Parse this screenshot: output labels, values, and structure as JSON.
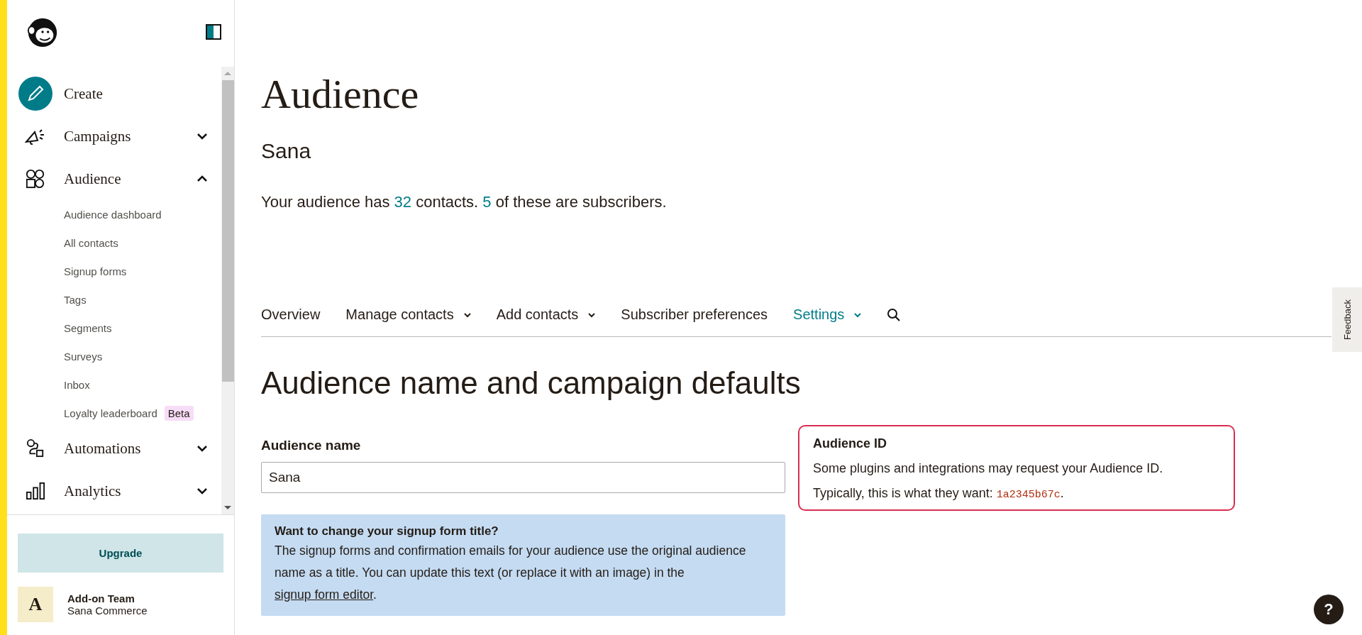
{
  "sidebar": {
    "nav": [
      {
        "label": "Create",
        "kind": "create"
      },
      {
        "label": "Campaigns",
        "kind": "section",
        "expanded": false
      },
      {
        "label": "Audience",
        "kind": "section",
        "expanded": true,
        "children": [
          {
            "label": "Audience dashboard"
          },
          {
            "label": "All contacts"
          },
          {
            "label": "Signup forms"
          },
          {
            "label": "Tags"
          },
          {
            "label": "Segments"
          },
          {
            "label": "Surveys"
          },
          {
            "label": "Inbox"
          },
          {
            "label": "Loyalty leaderboard",
            "badge": "Beta"
          }
        ]
      },
      {
        "label": "Automations",
        "kind": "section",
        "expanded": false
      },
      {
        "label": "Analytics",
        "kind": "section",
        "expanded": false
      }
    ],
    "upgrade_button": "Upgrade",
    "account": {
      "avatar_letter": "A",
      "name": "Add-on Team",
      "company": "Sana Commerce"
    }
  },
  "page": {
    "title": "Audience",
    "audience_name": "Sana",
    "stats": {
      "prefix": "Your audience has ",
      "contacts": "32",
      "middle": " contacts. ",
      "subscribers": "5",
      "suffix": " of these are subscribers."
    },
    "tabs": [
      {
        "label": "Overview",
        "has_menu": false,
        "selected": false
      },
      {
        "label": "Manage contacts",
        "has_menu": true,
        "selected": false
      },
      {
        "label": "Add contacts",
        "has_menu": true,
        "selected": false
      },
      {
        "label": "Subscriber preferences",
        "has_menu": false,
        "selected": false
      },
      {
        "label": "Settings",
        "has_menu": true,
        "selected": true
      }
    ],
    "section_title": "Audience name and campaign defaults",
    "name_field": {
      "label": "Audience name",
      "value": "Sana"
    },
    "info": {
      "title": "Want to change your signup form title?",
      "text": "The signup forms and confirmation emails for your audience use the original audience name as a title. You can update this text (or replace it with an image) in the ",
      "link": "signup form editor",
      "end": "."
    },
    "audience_id": {
      "title": "Audience ID",
      "text": "Some plugins and integrations may request your Audience ID.",
      "prefix": "Typically, this is what they want: ",
      "id": "1a2345b67c",
      "suffix": "."
    }
  },
  "feedback_tab": "Feedback",
  "help_button": "?"
}
